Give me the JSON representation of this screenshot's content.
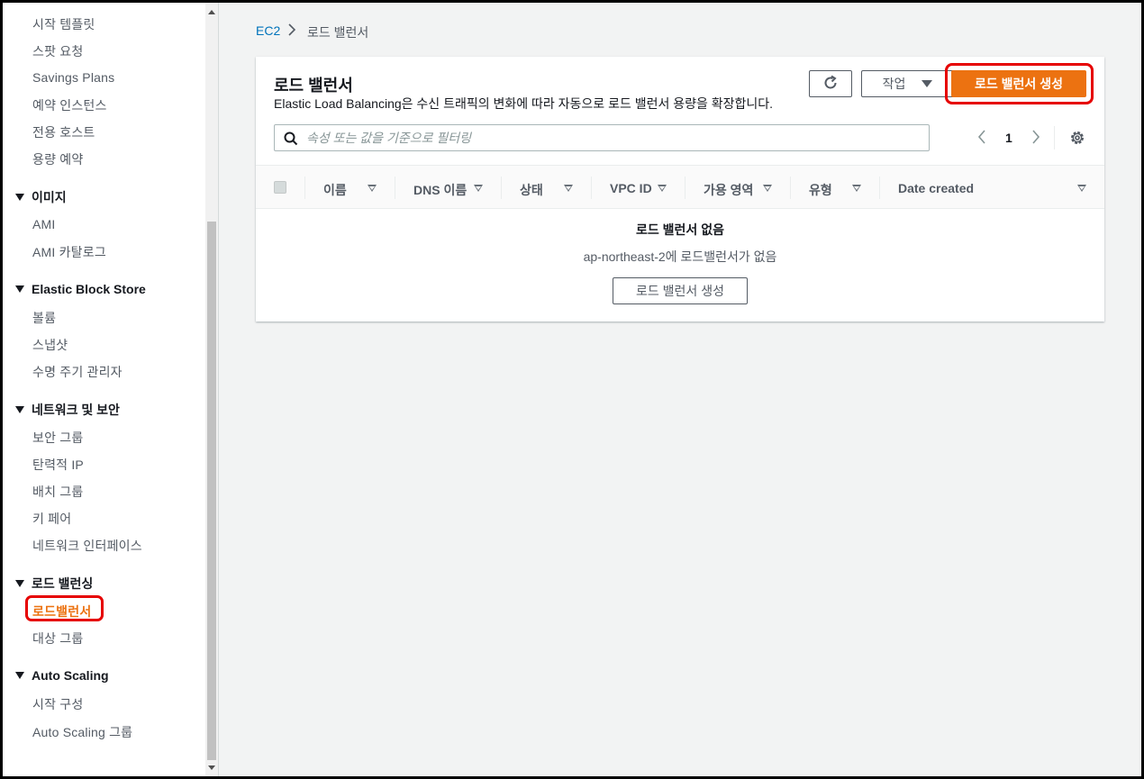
{
  "sidebar": {
    "items_top": [
      "시작 템플릿",
      "스팟 요청",
      "Savings Plans",
      "예약 인스턴스",
      "전용 호스트",
      "용량 예약"
    ],
    "sections": [
      {
        "title": "이미지",
        "items": [
          "AMI",
          "AMI 카탈로그"
        ]
      },
      {
        "title": "Elastic Block Store",
        "items": [
          "볼륨",
          "스냅샷",
          "수명 주기 관리자"
        ]
      },
      {
        "title": "네트워크 및 보안",
        "items": [
          "보안 그룹",
          "탄력적 IP",
          "배치 그룹",
          "키 페어",
          "네트워크 인터페이스"
        ]
      },
      {
        "title": "로드 밸런싱",
        "items": [
          "로드밸런서",
          "대상 그룹"
        ]
      },
      {
        "title": "Auto Scaling",
        "items": [
          "시작 구성",
          "Auto Scaling 그룹"
        ]
      }
    ],
    "active_item": "로드밸런서"
  },
  "breadcrumb": {
    "root": "EC2",
    "current": "로드 밸런서"
  },
  "panel": {
    "title": "로드 밸런서",
    "description": "Elastic Load Balancing은 수신 트래픽의 변화에 따라 자동으로 로드 밸런서 용량을 확장합니다.",
    "action_label": "작업",
    "create_label": "로드 밸런서 생성",
    "filter_placeholder": "속성 또는 값을 기준으로 필터링",
    "page_number": "1",
    "columns": [
      "이름",
      "DNS 이름",
      "상태",
      "VPC ID",
      "가용 영역",
      "유형",
      "Date created"
    ],
    "empty_title": "로드 밸런서 없음",
    "empty_desc": "ap-northeast-2에 로드밸런서가 없음",
    "empty_button": "로드 밸런서 생성"
  },
  "colors": {
    "accent": "#ec7211",
    "link": "#0073bb",
    "highlight": "#e60000"
  },
  "icons": [
    "refresh-icon",
    "search-icon",
    "chevron-left-icon",
    "chevron-right-icon",
    "settings-icon",
    "caret-down-icon"
  ]
}
